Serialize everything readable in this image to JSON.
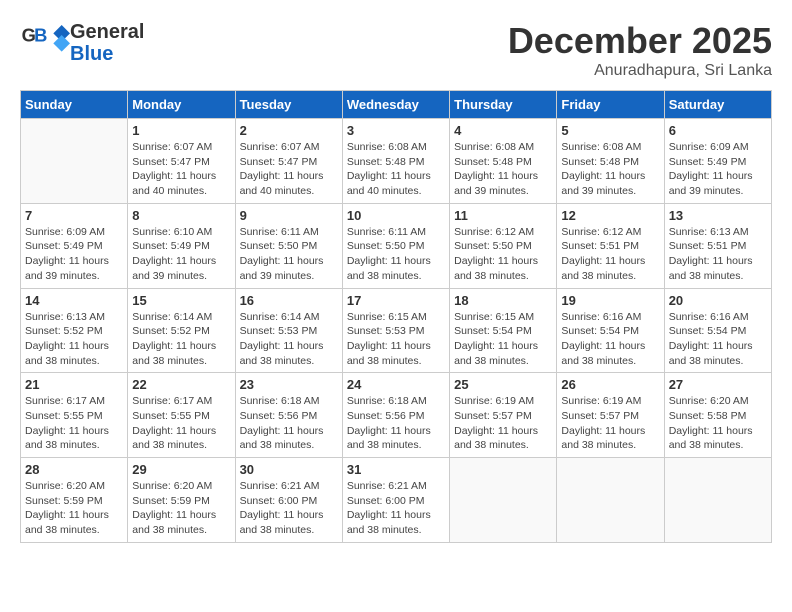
{
  "header": {
    "logo_general": "General",
    "logo_blue": "Blue",
    "month": "December 2025",
    "location": "Anuradhapura, Sri Lanka"
  },
  "weekdays": [
    "Sunday",
    "Monday",
    "Tuesday",
    "Wednesday",
    "Thursday",
    "Friday",
    "Saturday"
  ],
  "weeks": [
    [
      {
        "day": "",
        "sunrise": "",
        "sunset": "",
        "daylight": "",
        "empty": true
      },
      {
        "day": "1",
        "sunrise": "Sunrise: 6:07 AM",
        "sunset": "Sunset: 5:47 PM",
        "daylight": "Daylight: 11 hours and 40 minutes."
      },
      {
        "day": "2",
        "sunrise": "Sunrise: 6:07 AM",
        "sunset": "Sunset: 5:47 PM",
        "daylight": "Daylight: 11 hours and 40 minutes."
      },
      {
        "day": "3",
        "sunrise": "Sunrise: 6:08 AM",
        "sunset": "Sunset: 5:48 PM",
        "daylight": "Daylight: 11 hours and 40 minutes."
      },
      {
        "day": "4",
        "sunrise": "Sunrise: 6:08 AM",
        "sunset": "Sunset: 5:48 PM",
        "daylight": "Daylight: 11 hours and 39 minutes."
      },
      {
        "day": "5",
        "sunrise": "Sunrise: 6:08 AM",
        "sunset": "Sunset: 5:48 PM",
        "daylight": "Daylight: 11 hours and 39 minutes."
      },
      {
        "day": "6",
        "sunrise": "Sunrise: 6:09 AM",
        "sunset": "Sunset: 5:49 PM",
        "daylight": "Daylight: 11 hours and 39 minutes."
      }
    ],
    [
      {
        "day": "7",
        "sunrise": "Sunrise: 6:09 AM",
        "sunset": "Sunset: 5:49 PM",
        "daylight": "Daylight: 11 hours and 39 minutes."
      },
      {
        "day": "8",
        "sunrise": "Sunrise: 6:10 AM",
        "sunset": "Sunset: 5:49 PM",
        "daylight": "Daylight: 11 hours and 39 minutes."
      },
      {
        "day": "9",
        "sunrise": "Sunrise: 6:11 AM",
        "sunset": "Sunset: 5:50 PM",
        "daylight": "Daylight: 11 hours and 39 minutes."
      },
      {
        "day": "10",
        "sunrise": "Sunrise: 6:11 AM",
        "sunset": "Sunset: 5:50 PM",
        "daylight": "Daylight: 11 hours and 38 minutes."
      },
      {
        "day": "11",
        "sunrise": "Sunrise: 6:12 AM",
        "sunset": "Sunset: 5:50 PM",
        "daylight": "Daylight: 11 hours and 38 minutes."
      },
      {
        "day": "12",
        "sunrise": "Sunrise: 6:12 AM",
        "sunset": "Sunset: 5:51 PM",
        "daylight": "Daylight: 11 hours and 38 minutes."
      },
      {
        "day": "13",
        "sunrise": "Sunrise: 6:13 AM",
        "sunset": "Sunset: 5:51 PM",
        "daylight": "Daylight: 11 hours and 38 minutes."
      }
    ],
    [
      {
        "day": "14",
        "sunrise": "Sunrise: 6:13 AM",
        "sunset": "Sunset: 5:52 PM",
        "daylight": "Daylight: 11 hours and 38 minutes."
      },
      {
        "day": "15",
        "sunrise": "Sunrise: 6:14 AM",
        "sunset": "Sunset: 5:52 PM",
        "daylight": "Daylight: 11 hours and 38 minutes."
      },
      {
        "day": "16",
        "sunrise": "Sunrise: 6:14 AM",
        "sunset": "Sunset: 5:53 PM",
        "daylight": "Daylight: 11 hours and 38 minutes."
      },
      {
        "day": "17",
        "sunrise": "Sunrise: 6:15 AM",
        "sunset": "Sunset: 5:53 PM",
        "daylight": "Daylight: 11 hours and 38 minutes."
      },
      {
        "day": "18",
        "sunrise": "Sunrise: 6:15 AM",
        "sunset": "Sunset: 5:54 PM",
        "daylight": "Daylight: 11 hours and 38 minutes."
      },
      {
        "day": "19",
        "sunrise": "Sunrise: 6:16 AM",
        "sunset": "Sunset: 5:54 PM",
        "daylight": "Daylight: 11 hours and 38 minutes."
      },
      {
        "day": "20",
        "sunrise": "Sunrise: 6:16 AM",
        "sunset": "Sunset: 5:54 PM",
        "daylight": "Daylight: 11 hours and 38 minutes."
      }
    ],
    [
      {
        "day": "21",
        "sunrise": "Sunrise: 6:17 AM",
        "sunset": "Sunset: 5:55 PM",
        "daylight": "Daylight: 11 hours and 38 minutes."
      },
      {
        "day": "22",
        "sunrise": "Sunrise: 6:17 AM",
        "sunset": "Sunset: 5:55 PM",
        "daylight": "Daylight: 11 hours and 38 minutes."
      },
      {
        "day": "23",
        "sunrise": "Sunrise: 6:18 AM",
        "sunset": "Sunset: 5:56 PM",
        "daylight": "Daylight: 11 hours and 38 minutes."
      },
      {
        "day": "24",
        "sunrise": "Sunrise: 6:18 AM",
        "sunset": "Sunset: 5:56 PM",
        "daylight": "Daylight: 11 hours and 38 minutes."
      },
      {
        "day": "25",
        "sunrise": "Sunrise: 6:19 AM",
        "sunset": "Sunset: 5:57 PM",
        "daylight": "Daylight: 11 hours and 38 minutes."
      },
      {
        "day": "26",
        "sunrise": "Sunrise: 6:19 AM",
        "sunset": "Sunset: 5:57 PM",
        "daylight": "Daylight: 11 hours and 38 minutes."
      },
      {
        "day": "27",
        "sunrise": "Sunrise: 6:20 AM",
        "sunset": "Sunset: 5:58 PM",
        "daylight": "Daylight: 11 hours and 38 minutes."
      }
    ],
    [
      {
        "day": "28",
        "sunrise": "Sunrise: 6:20 AM",
        "sunset": "Sunset: 5:59 PM",
        "daylight": "Daylight: 11 hours and 38 minutes."
      },
      {
        "day": "29",
        "sunrise": "Sunrise: 6:20 AM",
        "sunset": "Sunset: 5:59 PM",
        "daylight": "Daylight: 11 hours and 38 minutes."
      },
      {
        "day": "30",
        "sunrise": "Sunrise: 6:21 AM",
        "sunset": "Sunset: 6:00 PM",
        "daylight": "Daylight: 11 hours and 38 minutes."
      },
      {
        "day": "31",
        "sunrise": "Sunrise: 6:21 AM",
        "sunset": "Sunset: 6:00 PM",
        "daylight": "Daylight: 11 hours and 38 minutes."
      },
      {
        "day": "",
        "sunrise": "",
        "sunset": "",
        "daylight": "",
        "empty": true
      },
      {
        "day": "",
        "sunrise": "",
        "sunset": "",
        "daylight": "",
        "empty": true
      },
      {
        "day": "",
        "sunrise": "",
        "sunset": "",
        "daylight": "",
        "empty": true
      }
    ]
  ]
}
